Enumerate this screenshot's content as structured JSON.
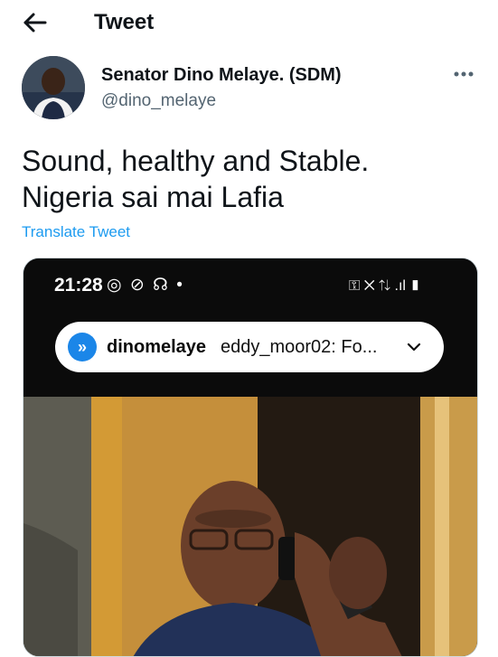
{
  "header": {
    "title": "Tweet"
  },
  "author": {
    "name": "Senator Dino Melaye. (SDM)",
    "handle": "@dino_melaye"
  },
  "tweet": {
    "lines": [
      "Sound, healthy and Stable.",
      "Nigeria sai mai Lafia"
    ],
    "translate_label": "Translate Tweet"
  },
  "media": {
    "status_time": "21:28",
    "notification": {
      "user": "dinomelaye",
      "message": "eddy_moor02: Fo..."
    }
  },
  "colors": {
    "link": "#1d9bf0",
    "secondary_text": "#536471",
    "notification_accent": "#1b86e8"
  }
}
